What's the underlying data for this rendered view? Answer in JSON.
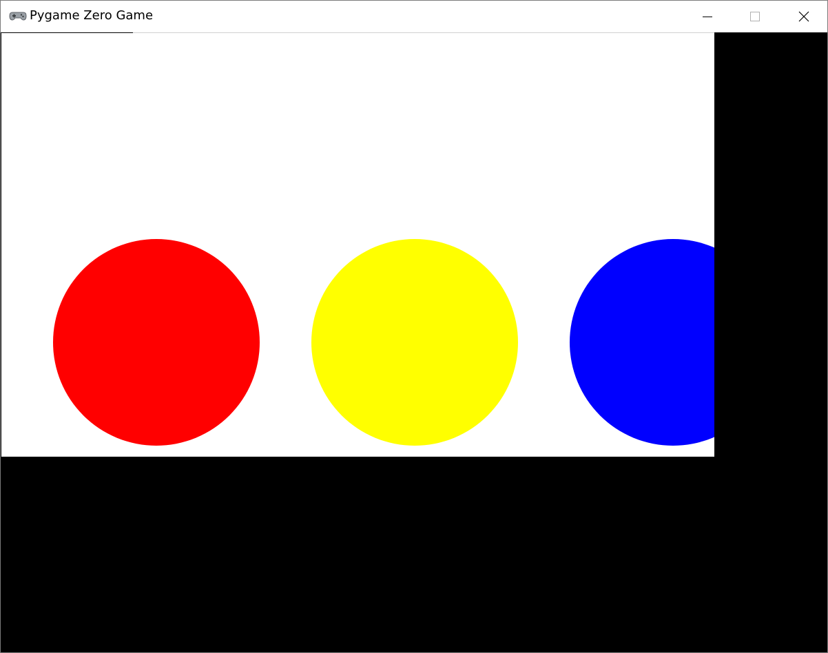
{
  "window": {
    "title": "Pygame Zero Game",
    "app_icon": "gamepad-icon",
    "controls": {
      "minimize": "minimize-icon",
      "maximize": "maximize-icon",
      "close": "close-icon"
    }
  },
  "game": {
    "background_color": "#ffffff",
    "outside_color": "#000000",
    "balls": [
      {
        "name": "red-ball",
        "color": "#ff0000"
      },
      {
        "name": "yellow-ball",
        "color": "#ffff00"
      },
      {
        "name": "blue-ball",
        "color": "#0000ff"
      }
    ]
  }
}
